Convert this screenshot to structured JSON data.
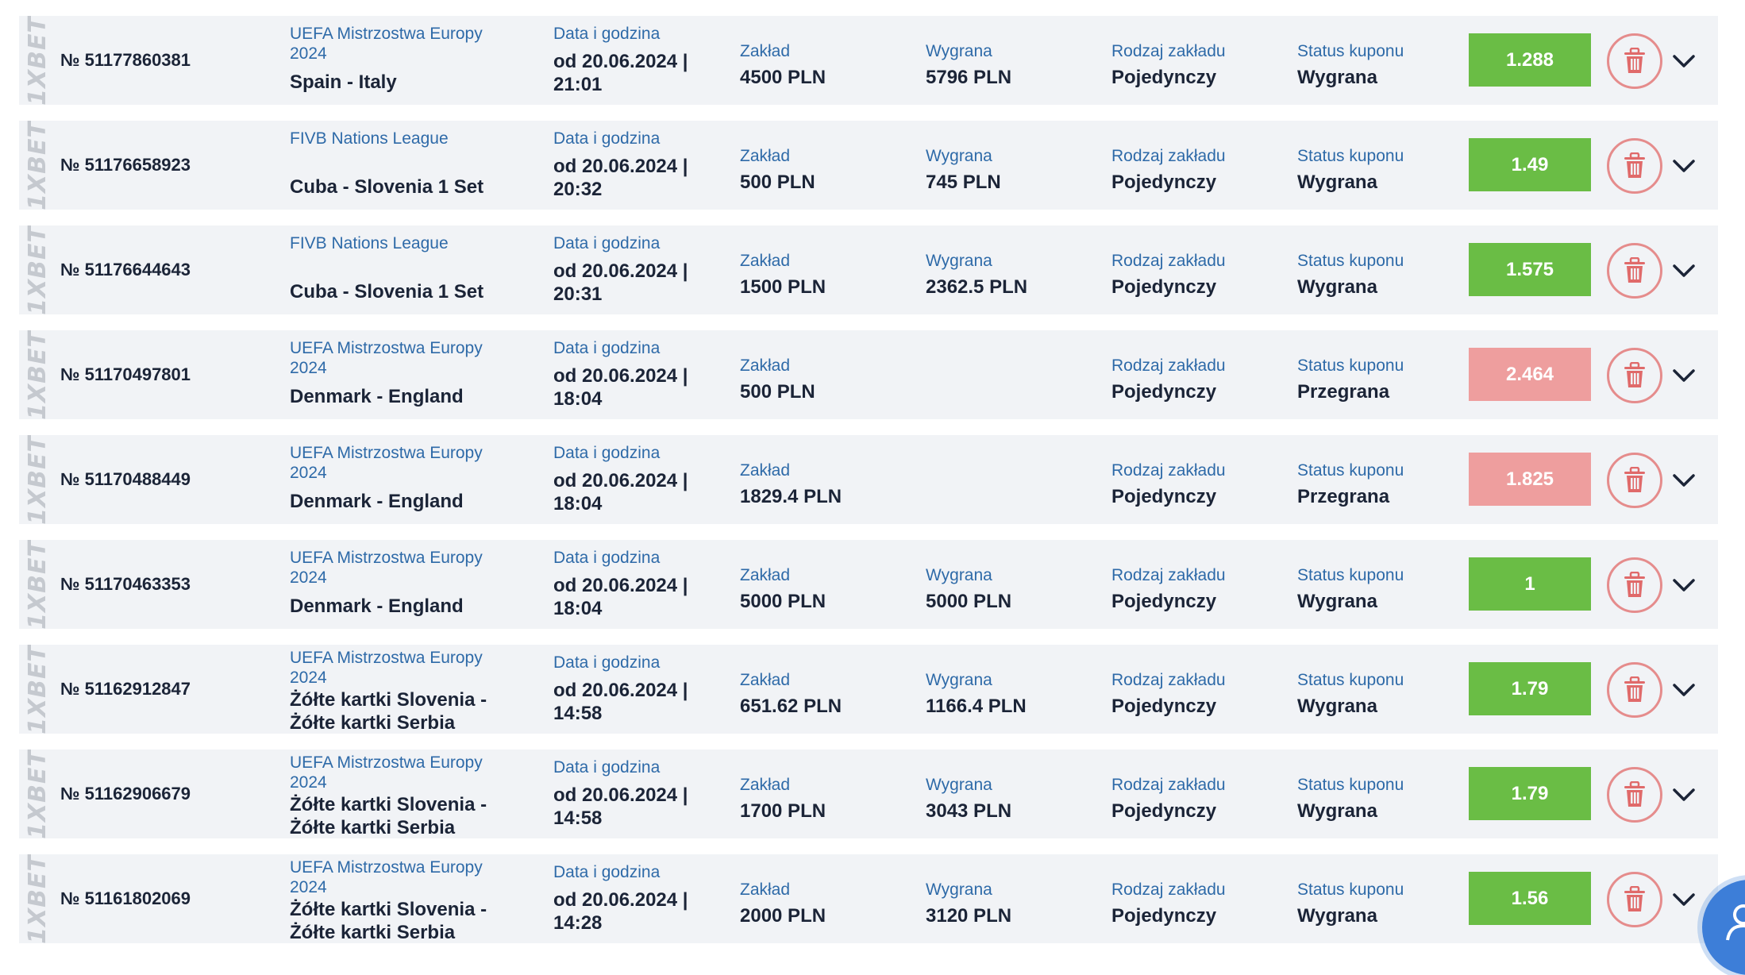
{
  "labels": {
    "date": "Data i godzina",
    "stake": "Zakład",
    "win": "Wygrana",
    "type": "Rodzaj zakładu",
    "status": "Status kuponu"
  },
  "brand_text": "1XBET",
  "colors": {
    "won": "#6abd45",
    "lost": "#ee9e9e",
    "label": "#2e6aa8",
    "text": "#1b2437"
  },
  "icons": {
    "delete": "trash-icon",
    "expand": "chevron-down-icon",
    "chat": "chat-icon"
  },
  "coupons": [
    {
      "number": "№ 51177860381",
      "league": "UEFA Mistrzostwa Europy 2024",
      "event": "Spain - Italy",
      "date": "od 20.06.2024 | 21:01",
      "stake": "4500 PLN",
      "win": "5796 PLN",
      "type": "Pojedynczy",
      "status": "Wygrana",
      "odds": "1.288",
      "result": "won"
    },
    {
      "number": "№ 51176658923",
      "league": "FIVB Nations League",
      "event": "Cuba - Slovenia 1 Set",
      "date": "od 20.06.2024 | 20:32",
      "stake": "500 PLN",
      "win": "745 PLN",
      "type": "Pojedynczy",
      "status": "Wygrana",
      "odds": "1.49",
      "result": "won"
    },
    {
      "number": "№ 51176644643",
      "league": "FIVB Nations League",
      "event": "Cuba - Slovenia 1 Set",
      "date": "od 20.06.2024 | 20:31",
      "stake": "1500 PLN",
      "win": "2362.5 PLN",
      "type": "Pojedynczy",
      "status": "Wygrana",
      "odds": "1.575",
      "result": "won"
    },
    {
      "number": "№ 51170497801",
      "league": "UEFA Mistrzostwa Europy 2024",
      "event": "Denmark - England",
      "date": "od 20.06.2024 | 18:04",
      "stake": "500 PLN",
      "win": null,
      "type": "Pojedynczy",
      "status": "Przegrana",
      "odds": "2.464",
      "result": "lost"
    },
    {
      "number": "№ 51170488449",
      "league": "UEFA Mistrzostwa Europy 2024",
      "event": "Denmark - England",
      "date": "od 20.06.2024 | 18:04",
      "stake": "1829.4 PLN",
      "win": null,
      "type": "Pojedynczy",
      "status": "Przegrana",
      "odds": "1.825",
      "result": "lost"
    },
    {
      "number": "№ 51170463353",
      "league": "UEFA Mistrzostwa Europy 2024",
      "event": "Denmark - England",
      "date": "od 20.06.2024 | 18:04",
      "stake": "5000 PLN",
      "win": "5000 PLN",
      "type": "Pojedynczy",
      "status": "Wygrana",
      "odds": "1",
      "result": "won"
    },
    {
      "number": "№ 51162912847",
      "league": "UEFA Mistrzostwa Europy 2024",
      "event": "Żółte kartki Slovenia - Żółte kartki Serbia",
      "date": "od 20.06.2024 | 14:58",
      "stake": "651.62 PLN",
      "win": "1166.4 PLN",
      "type": "Pojedynczy",
      "status": "Wygrana",
      "odds": "1.79",
      "result": "won"
    },
    {
      "number": "№ 51162906679",
      "league": "UEFA Mistrzostwa Europy 2024",
      "event": "Żółte kartki Slovenia - Żółte kartki Serbia",
      "date": "od 20.06.2024 | 14:58",
      "stake": "1700 PLN",
      "win": "3043 PLN",
      "type": "Pojedynczy",
      "status": "Wygrana",
      "odds": "1.79",
      "result": "won"
    },
    {
      "number": "№ 51161802069",
      "league": "UEFA Mistrzostwa Europy 2024",
      "event": "Żółte kartki Slovenia - Żółte kartki Serbia",
      "date": "od 20.06.2024 | 14:28",
      "stake": "2000 PLN",
      "win": "3120 PLN",
      "type": "Pojedynczy",
      "status": "Wygrana",
      "odds": "1.56",
      "result": "won"
    }
  ]
}
